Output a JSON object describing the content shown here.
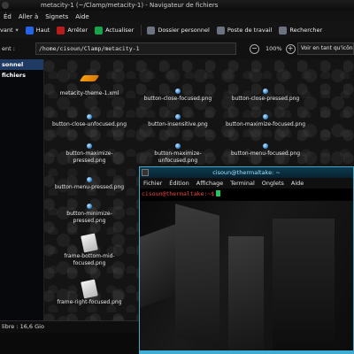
{
  "file_manager": {
    "title": "metacity-1 (~/Clamp/metacity-1) - Navigateur de fichiers",
    "menu": [
      "Éd",
      "Aller à",
      "Signets",
      "Aide"
    ],
    "toolbar": {
      "back_label": "vant",
      "up_label": "Haut",
      "stop_label": "Arrêter",
      "reload_label": "Actualiser",
      "home_label": "Dossier personnel",
      "desktop_label": "Poste de travail",
      "search_label": "Rechercher"
    },
    "location": {
      "label": "ent :",
      "path": "/home/cisoun/Clamp/metacity-1",
      "zoom": "100%",
      "view_as": "Voir en tant qu'icônes"
    },
    "sidebar": {
      "items": [
        {
          "label": "sonnel",
          "selected": true
        },
        {
          "label": "fichiers",
          "selected": false
        }
      ]
    },
    "files": [
      {
        "name": "metacity-theme-1.xml",
        "icon": "orange-shape-icon"
      },
      {
        "name": "button-close-focused.png",
        "icon": "blue-orb-icon"
      },
      {
        "name": "button-close-pressed.png",
        "icon": "blue-orb-icon"
      },
      {
        "name": "button-close-unfocused.png",
        "icon": "blue-orb-icon"
      },
      {
        "name": "button-insensitive.png",
        "icon": "blue-orb-icon"
      },
      {
        "name": "button-maximize-focused.png",
        "icon": "blue-orb-icon"
      },
      {
        "name": "button-maximize-pressed.png",
        "icon": "blue-orb-icon"
      },
      {
        "name": "button-maximize-unfocused.png",
        "icon": "blue-orb-icon"
      },
      {
        "name": "button-menu-focused.png",
        "icon": "blue-orb-icon"
      },
      {
        "name": "button-menu-pressed.png",
        "icon": "blue-orb-icon"
      },
      {
        "name": "button-minimize-pressed.png",
        "icon": "blue-orb-icon"
      },
      {
        "name": "frame-bottom-mid-focused.png",
        "icon": "page-icon"
      },
      {
        "name": "frame-right-focused.png",
        "icon": "page-icon"
      }
    ],
    "status": "libre : 16,6 Gio"
  },
  "terminal": {
    "title": "cisoun@thermaltake: ~",
    "menu": [
      "Fichier",
      "Édition",
      "Affichage",
      "Terminal",
      "Onglets",
      "Aide"
    ],
    "prompt": "cisoun@thermaltake:~$"
  },
  "colors": {
    "accent": "#3ab0d8",
    "prompt": "#ef4444",
    "cursor": "#22c55e",
    "selection": "#1f3b63"
  }
}
